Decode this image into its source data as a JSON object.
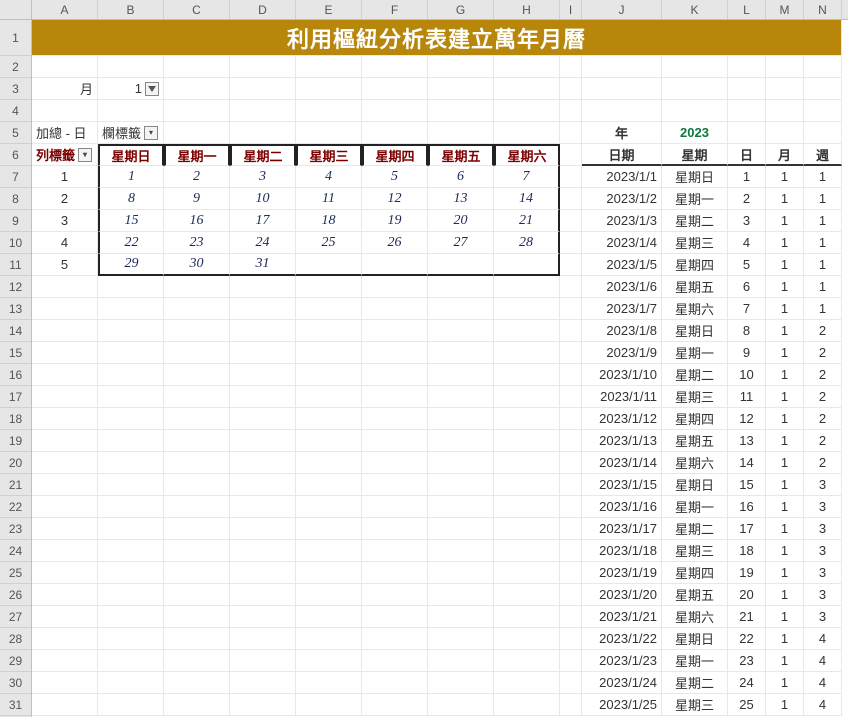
{
  "col_letters": [
    "A",
    "B",
    "C",
    "D",
    "E",
    "F",
    "G",
    "H",
    "I",
    "J",
    "K",
    "L",
    "M",
    "N"
  ],
  "row_nums": [
    1,
    2,
    3,
    4,
    5,
    6,
    7,
    8,
    9,
    10,
    11,
    12,
    13,
    14,
    15,
    16,
    17,
    18,
    19,
    20,
    21,
    22,
    23,
    24,
    25,
    26,
    27,
    28,
    29,
    30,
    31
  ],
  "title": "利用樞紐分析表建立萬年月曆",
  "month_label": "月",
  "month_value": "1",
  "pivot": {
    "sum_label": "加總 - 日",
    "col_header_label": "欄標籤",
    "row_header_label": "列標籤",
    "day_headers": [
      "星期日",
      "星期一",
      "星期二",
      "星期三",
      "星期四",
      "星期五",
      "星期六"
    ],
    "row_labels": [
      "1",
      "2",
      "3",
      "4",
      "5"
    ],
    "grid": [
      [
        "1",
        "2",
        "3",
        "4",
        "5",
        "6",
        "7"
      ],
      [
        "8",
        "9",
        "10",
        "11",
        "12",
        "13",
        "14"
      ],
      [
        "15",
        "16",
        "17",
        "18",
        "19",
        "20",
        "21"
      ],
      [
        "22",
        "23",
        "24",
        "25",
        "26",
        "27",
        "28"
      ],
      [
        "29",
        "30",
        "31",
        "",
        "",
        "",
        ""
      ]
    ]
  },
  "year_label": "年",
  "year_value": "2023",
  "data_headers": {
    "date": "日期",
    "weekday": "星期",
    "day": "日",
    "month": "月",
    "week": "週"
  },
  "data_rows": [
    {
      "date": "2023/1/1",
      "weekday": "星期日",
      "day": "1",
      "month": "1",
      "week": "1"
    },
    {
      "date": "2023/1/2",
      "weekday": "星期一",
      "day": "2",
      "month": "1",
      "week": "1"
    },
    {
      "date": "2023/1/3",
      "weekday": "星期二",
      "day": "3",
      "month": "1",
      "week": "1"
    },
    {
      "date": "2023/1/4",
      "weekday": "星期三",
      "day": "4",
      "month": "1",
      "week": "1"
    },
    {
      "date": "2023/1/5",
      "weekday": "星期四",
      "day": "5",
      "month": "1",
      "week": "1"
    },
    {
      "date": "2023/1/6",
      "weekday": "星期五",
      "day": "6",
      "month": "1",
      "week": "1"
    },
    {
      "date": "2023/1/7",
      "weekday": "星期六",
      "day": "7",
      "month": "1",
      "week": "1"
    },
    {
      "date": "2023/1/8",
      "weekday": "星期日",
      "day": "8",
      "month": "1",
      "week": "2"
    },
    {
      "date": "2023/1/9",
      "weekday": "星期一",
      "day": "9",
      "month": "1",
      "week": "2"
    },
    {
      "date": "2023/1/10",
      "weekday": "星期二",
      "day": "10",
      "month": "1",
      "week": "2"
    },
    {
      "date": "2023/1/11",
      "weekday": "星期三",
      "day": "11",
      "month": "1",
      "week": "2"
    },
    {
      "date": "2023/1/12",
      "weekday": "星期四",
      "day": "12",
      "month": "1",
      "week": "2"
    },
    {
      "date": "2023/1/13",
      "weekday": "星期五",
      "day": "13",
      "month": "1",
      "week": "2"
    },
    {
      "date": "2023/1/14",
      "weekday": "星期六",
      "day": "14",
      "month": "1",
      "week": "2"
    },
    {
      "date": "2023/1/15",
      "weekday": "星期日",
      "day": "15",
      "month": "1",
      "week": "3"
    },
    {
      "date": "2023/1/16",
      "weekday": "星期一",
      "day": "16",
      "month": "1",
      "week": "3"
    },
    {
      "date": "2023/1/17",
      "weekday": "星期二",
      "day": "17",
      "month": "1",
      "week": "3"
    },
    {
      "date": "2023/1/18",
      "weekday": "星期三",
      "day": "18",
      "month": "1",
      "week": "3"
    },
    {
      "date": "2023/1/19",
      "weekday": "星期四",
      "day": "19",
      "month": "1",
      "week": "3"
    },
    {
      "date": "2023/1/20",
      "weekday": "星期五",
      "day": "20",
      "month": "1",
      "week": "3"
    },
    {
      "date": "2023/1/21",
      "weekday": "星期六",
      "day": "21",
      "month": "1",
      "week": "3"
    },
    {
      "date": "2023/1/22",
      "weekday": "星期日",
      "day": "22",
      "month": "1",
      "week": "4"
    },
    {
      "date": "2023/1/23",
      "weekday": "星期一",
      "day": "23",
      "month": "1",
      "week": "4"
    },
    {
      "date": "2023/1/24",
      "weekday": "星期二",
      "day": "24",
      "month": "1",
      "week": "4"
    },
    {
      "date": "2023/1/25",
      "weekday": "星期三",
      "day": "25",
      "month": "1",
      "week": "4"
    }
  ]
}
